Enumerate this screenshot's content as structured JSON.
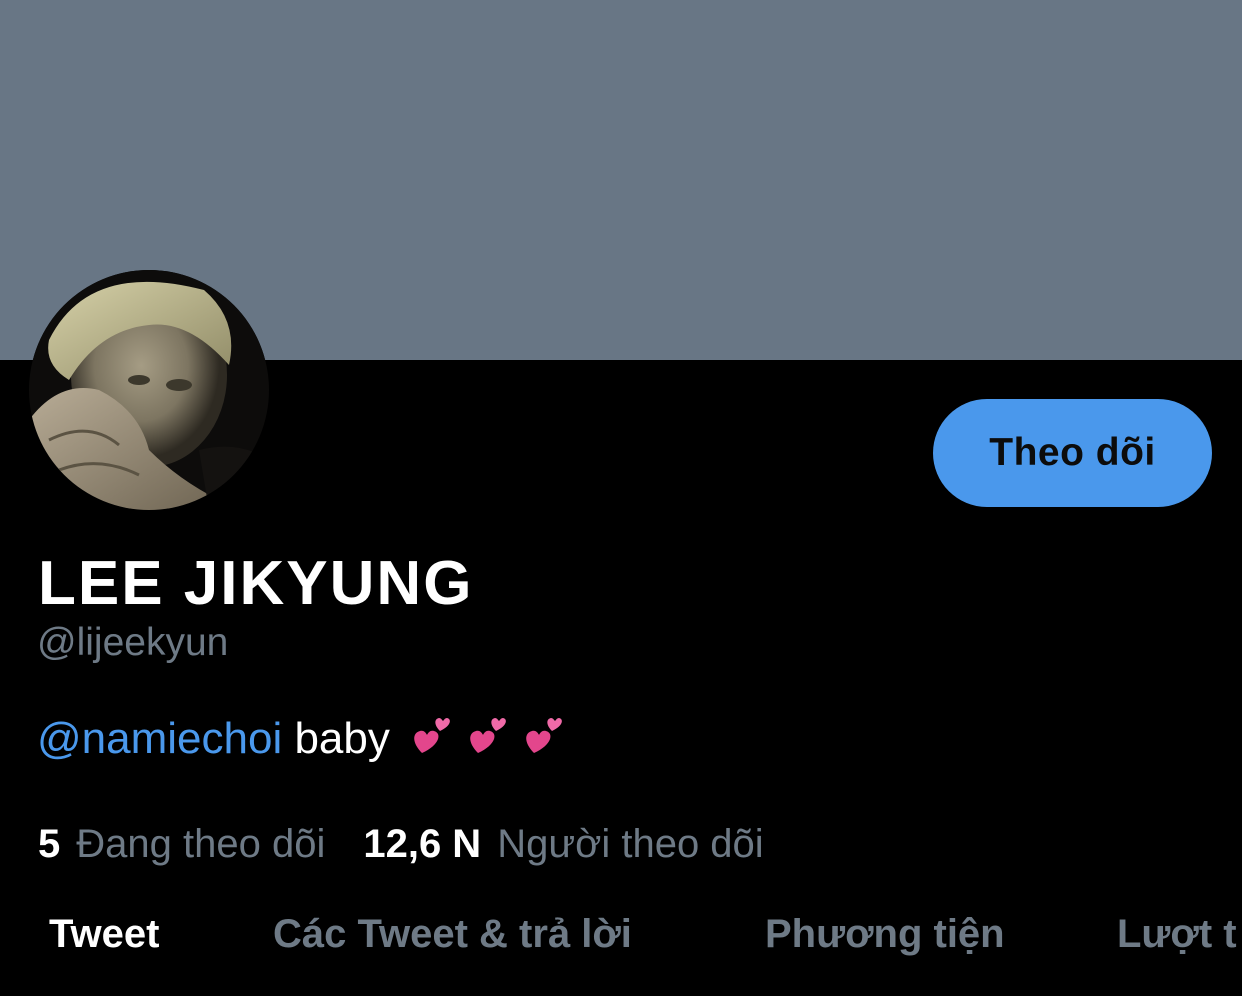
{
  "profile": {
    "display_name": "LEE JIKYUNG",
    "handle": "@lijeekyun",
    "follow_button_label": "Theo dõi",
    "bio": {
      "mention": "@namiechoi",
      "text": " baby",
      "emoji": [
        "💕",
        "💕",
        "💕"
      ]
    },
    "stats": {
      "following_count": "5",
      "following_label": "Đang theo dõi",
      "followers_count": "12,6 N",
      "followers_label": "Người theo dõi"
    }
  },
  "tabs": [
    {
      "label": "Tweet",
      "active": true
    },
    {
      "label": "Các Tweet & trả lời",
      "active": false
    },
    {
      "label": "Phương tiện",
      "active": false
    },
    {
      "label": "Lượt t",
      "active": false
    }
  ],
  "colors": {
    "banner": "#687685",
    "accent": "#4a98ec",
    "background": "#000000",
    "muted_text": "#6e7a86"
  }
}
